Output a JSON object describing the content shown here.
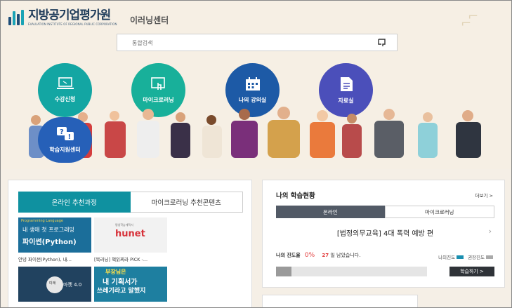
{
  "header": {
    "org_name": "지방공기업평가원",
    "org_english": "EVALUATION INSTITUTE OF REGIONAL PUBLIC CORPORATION",
    "center_name": "이러닝센터"
  },
  "search": {
    "placeholder": "통합검색"
  },
  "quick_menu": [
    {
      "label": "수강신청",
      "icon": "laptop-icon",
      "color": "#13a6a3"
    },
    {
      "label": "마이크로러닝",
      "icon": "touch-screen-icon",
      "color": "#18b09a"
    },
    {
      "label": "나의 강의실",
      "icon": "calendar-icon",
      "color": "#1d5aa6"
    },
    {
      "label": "자료실",
      "icon": "document-icon",
      "color": "#4b4fba"
    },
    {
      "label": "학습지원센터",
      "icon": "help-chat-icon",
      "color": "#2660b8"
    }
  ],
  "recommend": {
    "tabs": [
      "온라인 추천과정",
      "마이크로러닝 추천콘텐츠"
    ],
    "items": [
      {
        "caption": "안녕 파이썬(Python), 내...",
        "thumb_line1": "내 생애 첫 프로그래밍",
        "thumb_line2": "파이썬(Python)",
        "thumb_top": "Programming Language"
      },
      {
        "caption": "[북러닝] 책읽찌라 PiCK -...",
        "thumb_line1": "hunet",
        "thumb_top": "평생학습계획서"
      },
      {
        "caption": "",
        "thumb_line1": "미래",
        "thumb_line2": "마켓 4.0"
      },
      {
        "caption": "",
        "thumb_line1": "부장님은",
        "thumb_line2": "내 기획서가",
        "thumb_line3": "쓰레기라고 말했지"
      }
    ]
  },
  "my_status": {
    "title": "나의 학습현황",
    "more": "더보기 >",
    "tabs": [
      "온라인",
      "마이크로러닝"
    ],
    "course": "[법정의무교육] 4대 폭력 예방 편",
    "progress_label": "나의 진도율",
    "progress_value": "0%",
    "days_left_num": "27",
    "days_left_text": "일 남았습니다.",
    "legend_mine": "나의진도",
    "legend_recommended": "권장진도",
    "progress_fraction": 0.1,
    "study_button": "학습하기 >",
    "colors": {
      "mine": "#1a8fb0",
      "recommended": "#aaaaaa"
    }
  }
}
